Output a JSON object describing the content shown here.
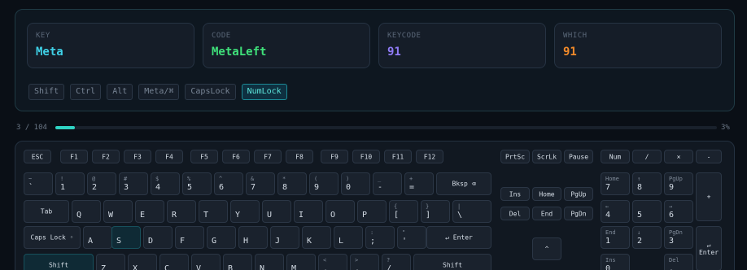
{
  "event": {
    "key_label": "KEY",
    "key_value": "Meta",
    "code_label": "CODE",
    "code_value": "MetaLeft",
    "keycode_label": "KEYCODE",
    "keycode_value": "91",
    "which_label": "WHICH",
    "which_value": "91"
  },
  "colors": {
    "key": "#3fd0e6",
    "code": "#3fe07a",
    "keycode": "#8f7bf5",
    "which": "#f08a2a",
    "accent": "#2fd3c3"
  },
  "modifiers": [
    {
      "label": "Shift",
      "active": false
    },
    {
      "label": "Ctrl",
      "active": false
    },
    {
      "label": "Alt",
      "active": false
    },
    {
      "label": "Meta/⌘",
      "active": false
    },
    {
      "label": "CapsLock",
      "active": false
    },
    {
      "label": "NumLock",
      "active": true
    }
  ],
  "progress": {
    "text": "3 / 104",
    "percent_text": "3%",
    "fraction": 0.03
  },
  "keys": [
    {
      "id": "esc",
      "c": "ESC"
    },
    {
      "id": "f1",
      "c": "F1"
    },
    {
      "id": "f2",
      "c": "F2"
    },
    {
      "id": "f3",
      "c": "F3"
    },
    {
      "id": "f4",
      "c": "F4"
    },
    {
      "id": "f5",
      "c": "F5"
    },
    {
      "id": "f6",
      "c": "F6"
    },
    {
      "id": "f7",
      "c": "F7"
    },
    {
      "id": "f8",
      "c": "F8"
    },
    {
      "id": "f9",
      "c": "F9"
    },
    {
      "id": "f10",
      "c": "F10"
    },
    {
      "id": "f11",
      "c": "F11"
    },
    {
      "id": "f12",
      "c": "F12"
    },
    {
      "id": "prtsc",
      "c": "PrtSc"
    },
    {
      "id": "scrlk",
      "c": "ScrLk"
    },
    {
      "id": "pause",
      "c": "Pause"
    },
    {
      "id": "num",
      "c": "Num"
    },
    {
      "id": "np-div",
      "c": "/"
    },
    {
      "id": "np-mul",
      "c": "×"
    },
    {
      "id": "np-sub",
      "c": "-"
    },
    {
      "id": "backquote",
      "t": "~",
      "b": "`"
    },
    {
      "id": "d1",
      "t": "!",
      "b": "1"
    },
    {
      "id": "d2",
      "t": "@",
      "b": "2"
    },
    {
      "id": "d3",
      "t": "#",
      "b": "3"
    },
    {
      "id": "d4",
      "t": "$",
      "b": "4"
    },
    {
      "id": "d5",
      "t": "%",
      "b": "5"
    },
    {
      "id": "d6",
      "t": "^",
      "b": "6"
    },
    {
      "id": "d7",
      "t": "&",
      "b": "7"
    },
    {
      "id": "d8",
      "t": "*",
      "b": "8"
    },
    {
      "id": "d9",
      "t": "(",
      "b": "9"
    },
    {
      "id": "d0",
      "t": ")",
      "b": "0"
    },
    {
      "id": "minus",
      "t": "_",
      "b": "-"
    },
    {
      "id": "equal",
      "t": "+",
      "b": "="
    },
    {
      "id": "bksp",
      "c": "Bksp ⌫"
    },
    {
      "id": "ins",
      "c": "Ins"
    },
    {
      "id": "home",
      "c": "Home"
    },
    {
      "id": "pgup",
      "c": "PgUp"
    },
    {
      "id": "np7",
      "t": "Home",
      "b": "7"
    },
    {
      "id": "np8",
      "t": "↑",
      "b": "8"
    },
    {
      "id": "np9",
      "t": "PgUp",
      "b": "9"
    },
    {
      "id": "np-add",
      "c": "+"
    },
    {
      "id": "tab",
      "c": "Tab"
    },
    {
      "id": "q",
      "b": "Q"
    },
    {
      "id": "w",
      "b": "W"
    },
    {
      "id": "e",
      "b": "E"
    },
    {
      "id": "r",
      "b": "R"
    },
    {
      "id": "tkey",
      "b": "T"
    },
    {
      "id": "y",
      "b": "Y"
    },
    {
      "id": "u",
      "b": "U"
    },
    {
      "id": "i",
      "b": "I"
    },
    {
      "id": "o",
      "b": "O"
    },
    {
      "id": "p",
      "b": "P"
    },
    {
      "id": "lbracket",
      "t": "{",
      "b": "["
    },
    {
      "id": "rbracket",
      "t": "}",
      "b": "]"
    },
    {
      "id": "backslash",
      "t": "|",
      "b": "\\"
    },
    {
      "id": "del",
      "c": "Del"
    },
    {
      "id": "end",
      "c": "End"
    },
    {
      "id": "pgdn",
      "c": "PgDn"
    },
    {
      "id": "np4",
      "t": "←",
      "b": "4"
    },
    {
      "id": "np5",
      "b": "5"
    },
    {
      "id": "np6",
      "t": "→",
      "b": "6"
    },
    {
      "id": "capslock",
      "c": "Caps Lock ◦"
    },
    {
      "id": "a",
      "b": "A"
    },
    {
      "id": "s",
      "b": "S"
    },
    {
      "id": "d",
      "b": "D"
    },
    {
      "id": "f",
      "b": "F"
    },
    {
      "id": "g",
      "b": "G"
    },
    {
      "id": "h",
      "b": "H"
    },
    {
      "id": "j",
      "b": "J"
    },
    {
      "id": "k",
      "b": "K"
    },
    {
      "id": "l",
      "b": "L"
    },
    {
      "id": "semicolon",
      "t": ":",
      "b": ";"
    },
    {
      "id": "quote",
      "t": "\"",
      "b": "'"
    },
    {
      "id": "enter",
      "c": "↵ Enter"
    },
    {
      "id": "np1",
      "t": "End",
      "b": "1"
    },
    {
      "id": "np2",
      "t": "↓",
      "b": "2"
    },
    {
      "id": "np3",
      "t": "PgDn",
      "b": "3"
    },
    {
      "id": "np-enter",
      "c": "↵ Enter"
    },
    {
      "id": "shiftl",
      "c": "Shift"
    },
    {
      "id": "z",
      "b": "Z"
    },
    {
      "id": "x",
      "b": "X"
    },
    {
      "id": "ck",
      "b": "C"
    },
    {
      "id": "v",
      "b": "V"
    },
    {
      "id": "bk",
      "b": "B"
    },
    {
      "id": "n",
      "b": "N"
    },
    {
      "id": "m",
      "b": "M"
    },
    {
      "id": "comma",
      "t": "<",
      "b": ","
    },
    {
      "id": "period",
      "t": ">",
      "b": "."
    },
    {
      "id": "slash",
      "t": "?",
      "b": "/"
    },
    {
      "id": "shiftr",
      "c": "Shift"
    },
    {
      "id": "up",
      "c": "^"
    },
    {
      "id": "np0",
      "t": "Ins",
      "b": "0"
    },
    {
      "id": "npdot",
      "t": "Del",
      "b": "."
    }
  ]
}
